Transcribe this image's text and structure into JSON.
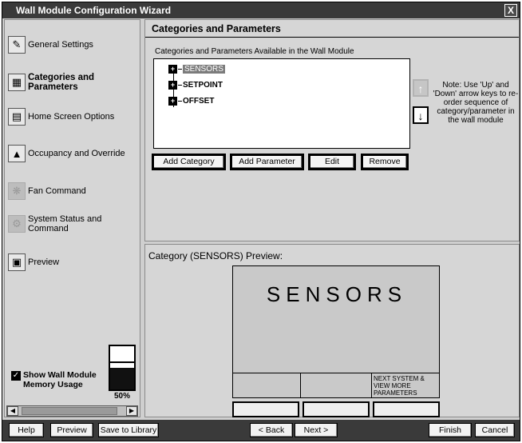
{
  "window": {
    "title": "Wall Module Configuration Wizard",
    "close_label": "X"
  },
  "sidebar": {
    "items": [
      {
        "label": "General Settings",
        "icon": "settings-icon"
      },
      {
        "label": "Categories and Parameters",
        "icon": "tree-icon"
      },
      {
        "label": "Home Screen Options",
        "icon": "screen-icon"
      },
      {
        "label": "Occupancy and Override",
        "icon": "occupancy-icon"
      },
      {
        "label": "Fan Command",
        "icon": "fan-icon"
      },
      {
        "label": "System Status and Command",
        "icon": "status-icon"
      },
      {
        "label": "Preview",
        "icon": "preview-icon"
      }
    ],
    "active_index": 1,
    "memory": {
      "label": "Show Wall Module Memory Usage",
      "checked": true,
      "usage_percent": 50,
      "usage_text": "50%"
    }
  },
  "main": {
    "title": "Categories and Parameters",
    "list_caption": "Categories and Parameters Available in the Wall Module",
    "tree": [
      {
        "label": "SENSORS",
        "selected": true
      },
      {
        "label": "SETPOINT",
        "selected": false
      },
      {
        "label": "OFFSET",
        "selected": false
      }
    ],
    "buttons": {
      "add_category": "Add Category",
      "add_parameter": "Add Parameter",
      "edit": "Edit",
      "remove": "Remove"
    },
    "note": "Note: Use 'Up' and 'Down' arrow keys to re-order sequence of category/parameter in the wall module",
    "arrows": {
      "up": "↑",
      "down": "↓"
    }
  },
  "preview": {
    "caption": "Category (SENSORS) Preview:",
    "screen_text": "SENSORS",
    "soft_label_3": "NEXT SYSTEM & VIEW MORE PARAMETERS"
  },
  "footer": {
    "help": "Help",
    "preview": "Preview",
    "save_to_library": "Save to Library",
    "back": "< Back",
    "next": "Next >",
    "finish": "Finish",
    "cancel": "Cancel"
  },
  "colors": {
    "titlebar": "#3a3a3a",
    "panel": "#d6d6d6",
    "selection": "#7c7c7c"
  }
}
